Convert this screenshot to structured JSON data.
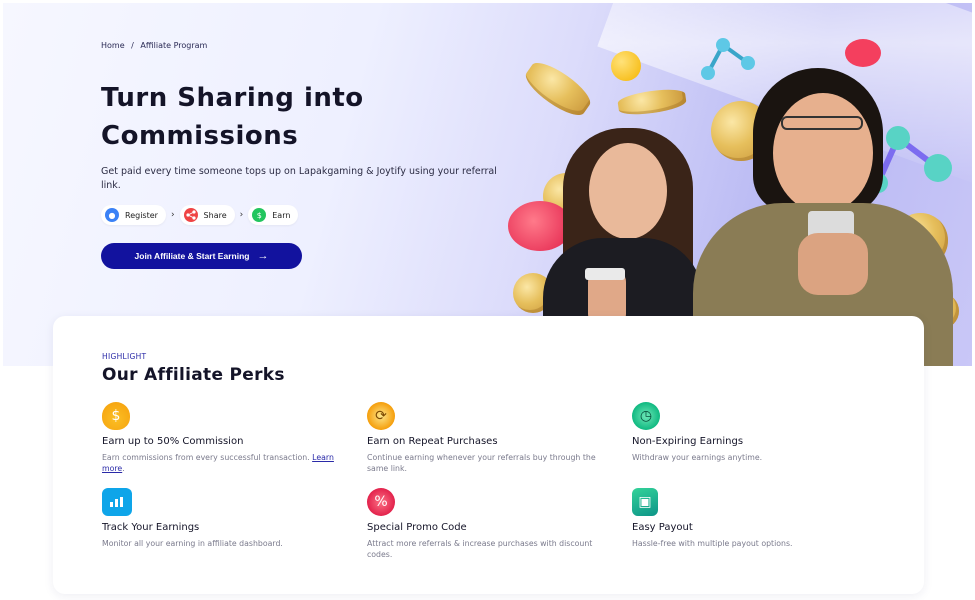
{
  "breadcrumb": {
    "home": "Home",
    "separator": "/",
    "current": "Affiliate Program"
  },
  "hero": {
    "title": "Turn Sharing into Commissions",
    "subtitle": "Get paid every time someone tops up on Lapakgaming & Joytify using your referral link.",
    "steps": [
      {
        "label": "Register",
        "icon": "user-icon",
        "color": "#3b82f6"
      },
      {
        "label": "Share",
        "icon": "share-icon",
        "color": "#ef4444"
      },
      {
        "label": "Earn",
        "icon": "money-icon",
        "color": "#22c55e"
      }
    ],
    "cta_label": "Join Affiliate & Start Earning"
  },
  "perks": {
    "eyebrow": "HIGHLIGHT",
    "title": "Our Affiliate Perks",
    "items": [
      {
        "title": "Earn up to 50% Commission",
        "desc": "Earn commissions from every successful transaction.",
        "link": "Learn more",
        "tail": ".",
        "icon": "money-bag-icon",
        "color": "#f59e0b"
      },
      {
        "title": "Earn on Repeat Purchases",
        "desc": "Continue earning whenever your referrals buy through the same link.",
        "icon": "repeat-coin-icon",
        "color": "#f59e0b"
      },
      {
        "title": "Non-Expiring Earnings",
        "desc": "Withdraw your earnings anytime.",
        "icon": "stopwatch-icon",
        "color": "#10b981"
      },
      {
        "title": "Track Your Earnings",
        "desc": "Monitor all your earning in affiliate dashboard.",
        "icon": "dashboard-icon",
        "color": "#0ea5e9"
      },
      {
        "title": "Special Promo Code",
        "desc": "Attract more referrals & increase purchases with discount codes.",
        "icon": "promo-badge-icon",
        "color": "#e11d48"
      },
      {
        "title": "Easy Payout",
        "desc": "Hassle-free with multiple payout options.",
        "icon": "wallet-icon",
        "color": "#0d9488"
      }
    ]
  }
}
